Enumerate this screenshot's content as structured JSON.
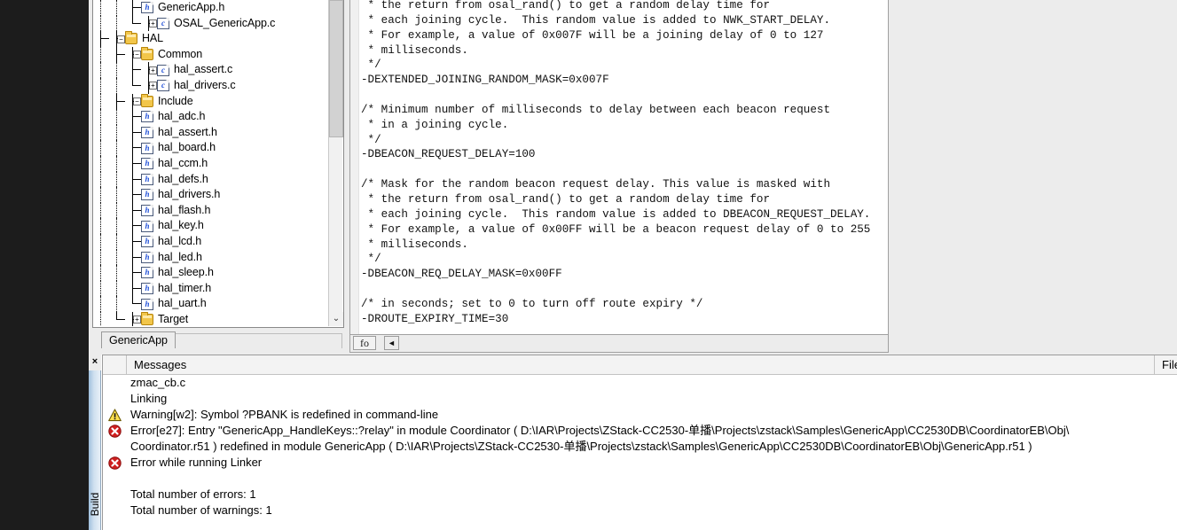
{
  "workspace": {
    "tab_label": "GenericApp",
    "tree": [
      {
        "indent": 3,
        "connector": "tee",
        "expander": "none",
        "icon": "h-file-icon",
        "label": "GenericApp.h"
      },
      {
        "indent": 3,
        "connector": "ell",
        "expander": "plus",
        "icon": "c-file-icon",
        "label": "OSAL_GenericApp.c"
      },
      {
        "indent": 1,
        "connector": "tee",
        "expander": "minus",
        "icon": "folder-icon",
        "label": "HAL"
      },
      {
        "indent": 2,
        "connector": "tee",
        "expander": "minus",
        "icon": "folder-icon",
        "label": "Common"
      },
      {
        "indent": 3,
        "connector": "tee",
        "expander": "plus",
        "icon": "c-file-icon",
        "label": "hal_assert.c"
      },
      {
        "indent": 3,
        "connector": "ell",
        "expander": "plus",
        "icon": "c-file-icon",
        "label": "hal_drivers.c"
      },
      {
        "indent": 2,
        "connector": "tee",
        "expander": "minus",
        "icon": "folder-icon",
        "label": "Include"
      },
      {
        "indent": 3,
        "connector": "tee",
        "expander": "none",
        "icon": "h-file-icon",
        "label": "hal_adc.h"
      },
      {
        "indent": 3,
        "connector": "tee",
        "expander": "none",
        "icon": "h-file-icon",
        "label": "hal_assert.h"
      },
      {
        "indent": 3,
        "connector": "tee",
        "expander": "none",
        "icon": "h-file-icon",
        "label": "hal_board.h"
      },
      {
        "indent": 3,
        "connector": "tee",
        "expander": "none",
        "icon": "h-file-icon",
        "label": "hal_ccm.h"
      },
      {
        "indent": 3,
        "connector": "tee",
        "expander": "none",
        "icon": "h-file-icon",
        "label": "hal_defs.h"
      },
      {
        "indent": 3,
        "connector": "tee",
        "expander": "none",
        "icon": "h-file-icon",
        "label": "hal_drivers.h"
      },
      {
        "indent": 3,
        "connector": "tee",
        "expander": "none",
        "icon": "h-file-icon",
        "label": "hal_flash.h"
      },
      {
        "indent": 3,
        "connector": "tee",
        "expander": "none",
        "icon": "h-file-icon",
        "label": "hal_key.h"
      },
      {
        "indent": 3,
        "connector": "tee",
        "expander": "none",
        "icon": "h-file-icon",
        "label": "hal_lcd.h"
      },
      {
        "indent": 3,
        "connector": "tee",
        "expander": "none",
        "icon": "h-file-icon",
        "label": "hal_led.h"
      },
      {
        "indent": 3,
        "connector": "tee",
        "expander": "none",
        "icon": "h-file-icon",
        "label": "hal_sleep.h"
      },
      {
        "indent": 3,
        "connector": "tee",
        "expander": "none",
        "icon": "h-file-icon",
        "label": "hal_timer.h"
      },
      {
        "indent": 3,
        "connector": "ell",
        "expander": "none",
        "icon": "h-file-icon",
        "label": "hal_uart.h"
      },
      {
        "indent": 2,
        "connector": "ell",
        "expander": "plus",
        "icon": "folder-icon",
        "label": "Target"
      }
    ],
    "scroll_down_glyph": "⌄"
  },
  "editor": {
    "code": " * the return from osal_rand() to get a random delay time for\n * each joining cycle.  This random value is added to NWK_START_DELAY.\n * For example, a value of 0x007F will be a joining delay of 0 to 127\n * milliseconds.\n */\n-DEXTENDED_JOINING_RANDOM_MASK=0x007F\n\n/* Minimum number of milliseconds to delay between each beacon request\n * in a joining cycle.\n */\n-DBEACON_REQUEST_DELAY=100\n\n/* Mask for the random beacon request delay. This value is masked with\n * the return from osal_rand() to get a random delay time for\n * each joining cycle.  This random value is added to DBEACON_REQUEST_DELAY.\n * For example, a value of 0x00FF will be a beacon request delay of 0 to 255\n * milliseconds.\n */\n-DBEACON_REQ_DELAY_MASK=0x00FF\n\n/* in seconds; set to 0 to turn off route expiry */\n-DROUTE_EXPIRY_TIME=30",
    "status_label": "fo",
    "scroll_left_glyph": "◄"
  },
  "messages_panel": {
    "close_glyph": "×",
    "dock_tab_label": "Build",
    "columns": [
      "",
      "Messages",
      "File"
    ],
    "rows": [
      {
        "severity": "none",
        "text": "zmac_cb.c"
      },
      {
        "severity": "none",
        "text": "Linking"
      },
      {
        "severity": "warning",
        "text": "Warning[w2]: Symbol ?PBANK is redefined in command-line"
      },
      {
        "severity": "error",
        "text": "Error[e27]: Entry \"GenericApp_HandleKeys::?relay\" in module Coordinator ( D:\\IAR\\Projects\\ZStack-CC2530-单播\\Projects\\zstack\\Samples\\GenericApp\\CC2530DB\\CoordinatorEB\\Obj\\"
      },
      {
        "severity": "none",
        "text": "Coordinator.r51 ) redefined in module GenericApp ( D:\\IAR\\Projects\\ZStack-CC2530-单播\\Projects\\zstack\\Samples\\GenericApp\\CC2530DB\\CoordinatorEB\\Obj\\GenericApp.r51 )"
      },
      {
        "severity": "error",
        "text": "Error while running Linker"
      },
      {
        "severity": "none",
        "text": ""
      },
      {
        "severity": "none",
        "text": "Total number of errors: 1"
      },
      {
        "severity": "none",
        "text": "Total number of warnings: 1"
      }
    ]
  },
  "colors": {
    "warning": "#f2c200",
    "error": "#cc1b1b",
    "folder": "#f2c64a",
    "file_letter": "#1f4fd8",
    "panel_bg": "#ececec"
  }
}
